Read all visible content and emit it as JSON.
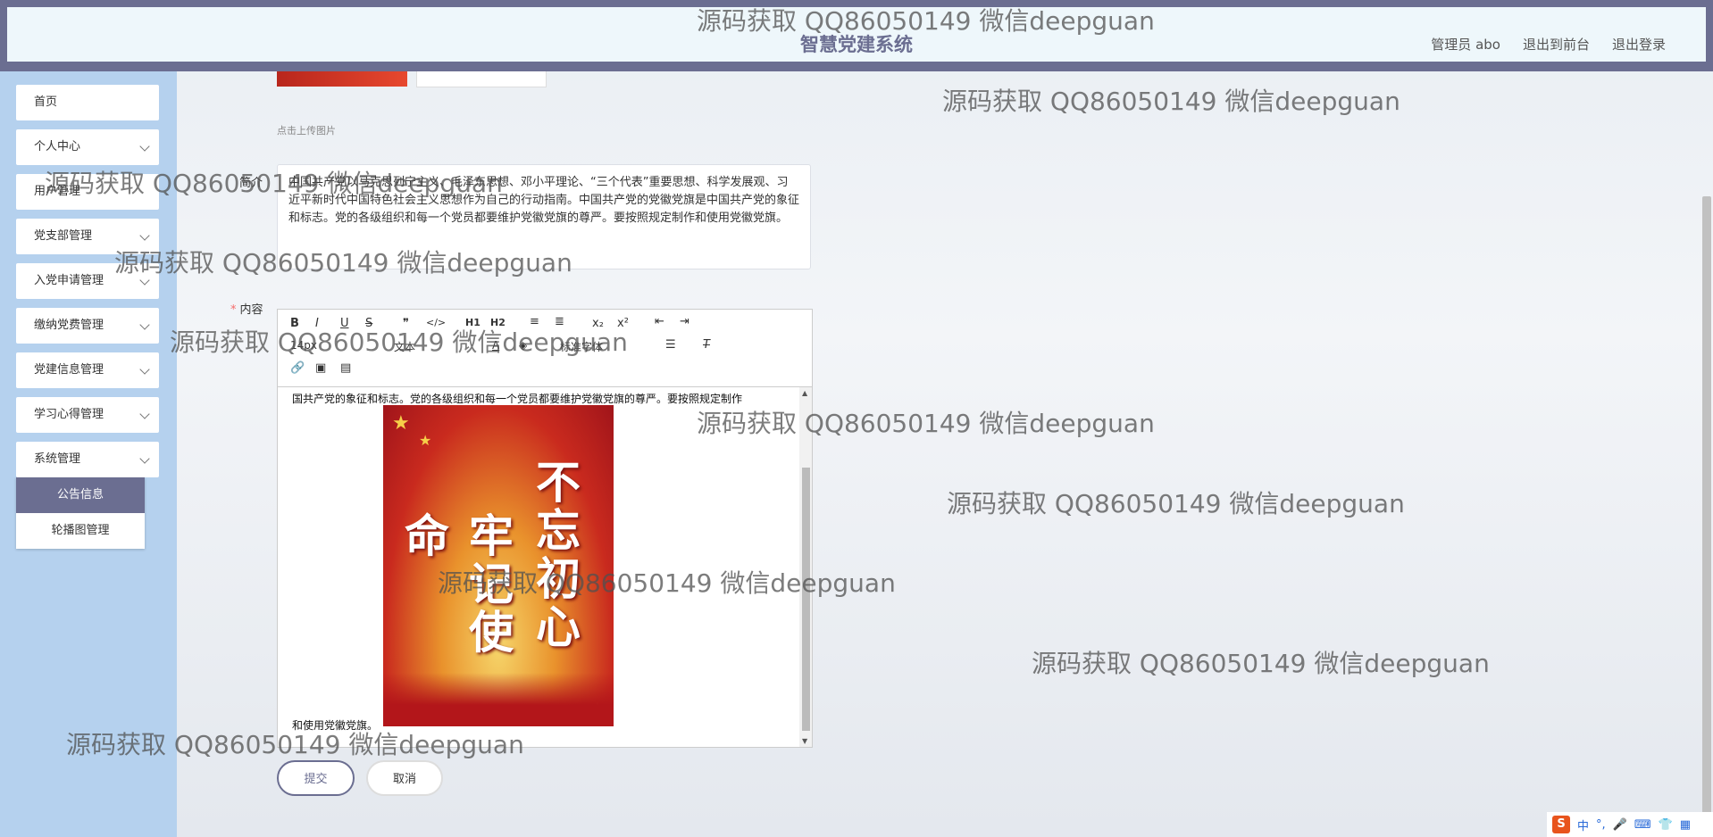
{
  "header": {
    "title": "智慧党建系统",
    "links": [
      "管理员 abo",
      "退出到前台",
      "退出登录"
    ]
  },
  "sidebar": {
    "items": [
      "首页",
      "个人中心",
      "用户管理",
      "党支部管理",
      "入党申请管理",
      "缴纳党费管理",
      "党建信息管理",
      "学习心得管理",
      "系统管理"
    ],
    "submenu": [
      "公告信息",
      "轮播图管理"
    ]
  },
  "form": {
    "upload_hint": "点击上传图片",
    "summary_label": "简介",
    "summary_text": "中国共产党以马克思列宁主义、毛泽东思想、邓小平理论、“三个代表”重要思想、科学发展观、习近平新时代中国特色社会主义思想作为自己的行动指南。中国共产党的党徽党旗是中国共产党的象征和标志。党的各级组织和每一个党员都要维护党徽党旗的尊严。要按照规定制作和使用党徽党旗。",
    "content_label": "内容",
    "submit_label": "提交",
    "cancel_label": "取消"
  },
  "editor": {
    "toolbar_row1": [
      "B",
      "I",
      "U",
      "S",
      "❞",
      "</>",
      "H1",
      "H2",
      "≡",
      "≣",
      "x₂",
      "x²",
      "⇤",
      "⇥"
    ],
    "font_size": "14px",
    "text_style": "文本",
    "font_family": "标准字体",
    "line1": "国共产党的象征和标志。党的各级组织和每一个党员都要维护党徽党旗的尊严。要按照规定制作",
    "line2": "和使用党徽党旗。",
    "poster_text_1": "不忘初心",
    "poster_text_2": "牢记使命"
  },
  "ime": {
    "logo": "S",
    "mode": "中"
  },
  "watermark": "源码获取 QQ86050149 微信deepguan"
}
